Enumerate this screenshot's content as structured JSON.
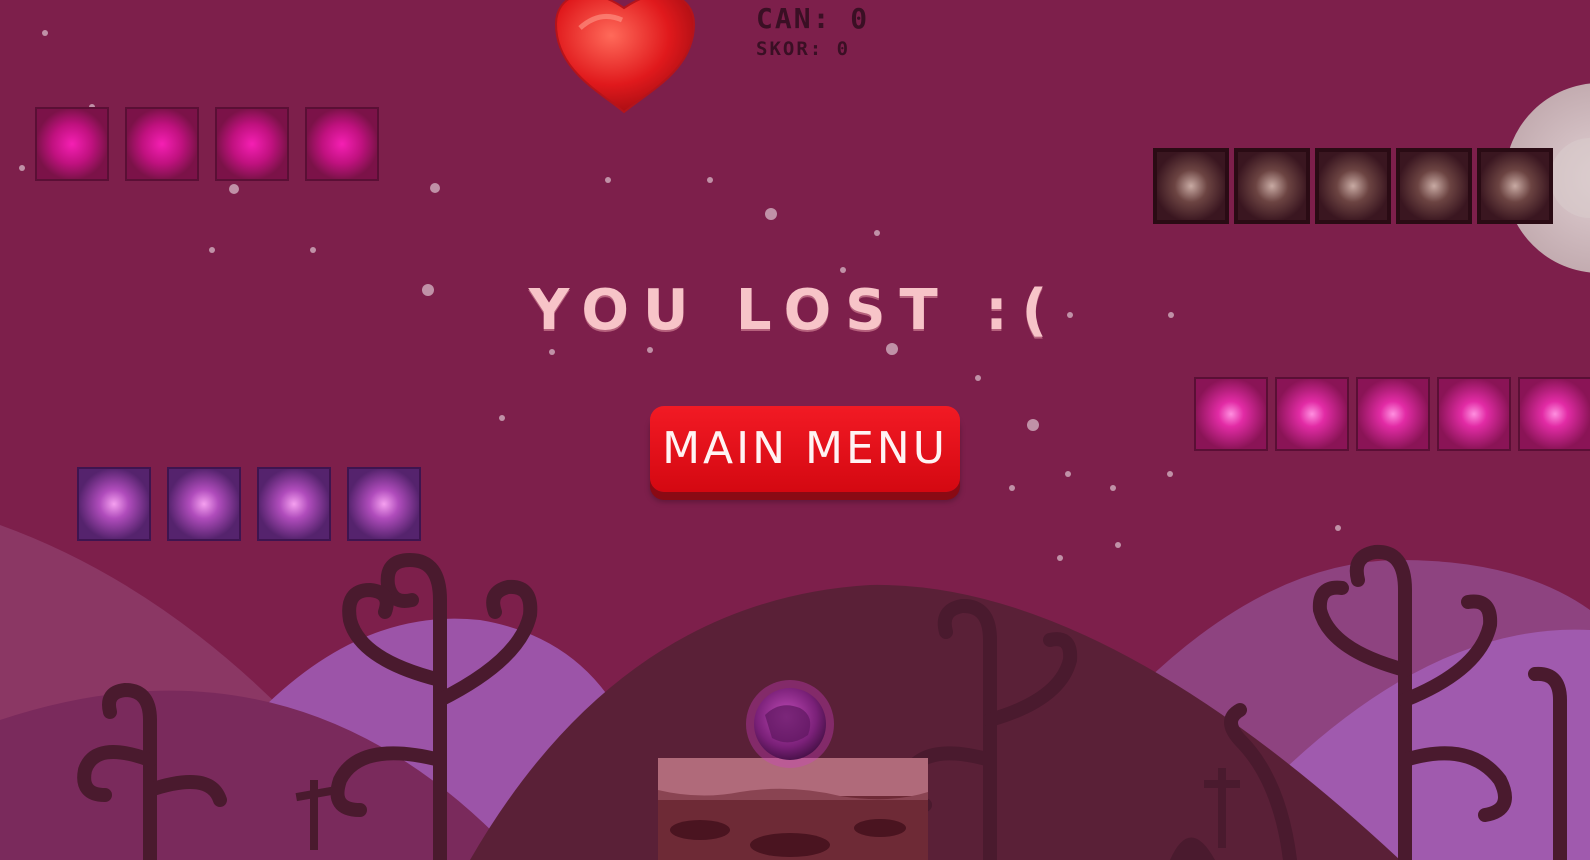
{
  "hud": {
    "lives_text": "CAN: 0",
    "score_text": "SKOR: 0",
    "lives_icon": "heart-icon"
  },
  "screen": {
    "title": "YOU LOST :(",
    "main_menu_label": "MAIN MENU"
  },
  "colors": {
    "sky": "#7d1f4b",
    "button": "#ea111b",
    "title_text": "#f7c4c8",
    "pink_block": "#d0128e",
    "dark_block": "#3b1420",
    "purple_block": "#7c2f8a"
  },
  "platforms": [
    {
      "name": "pink-block-row-top-left",
      "blocks": 4,
      "style": "pink"
    },
    {
      "name": "dark-block-row-top-right",
      "blocks": 5,
      "style": "dark"
    },
    {
      "name": "pink-block-row-right",
      "blocks": 5,
      "style": "pink"
    },
    {
      "name": "purple-block-row-left",
      "blocks": 4,
      "style": "purple"
    }
  ]
}
